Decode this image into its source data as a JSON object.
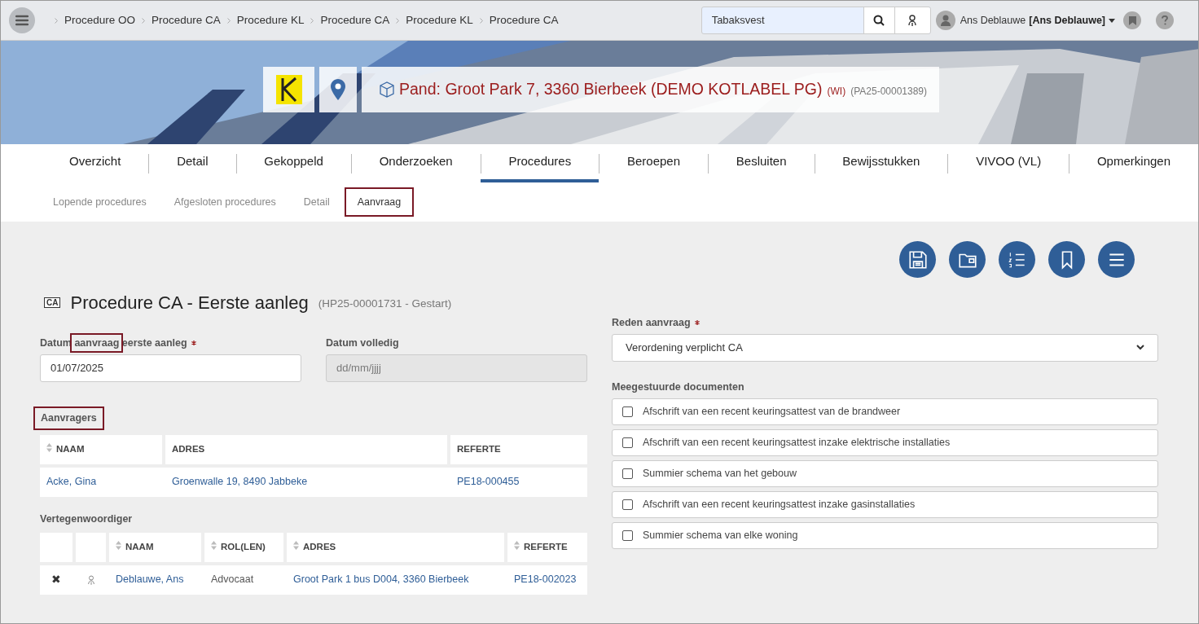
{
  "breadcrumbs": [
    "Procedure OO",
    "Procedure CA",
    "Procedure KL",
    "Procedure CA",
    "Procedure KL",
    "Procedure CA"
  ],
  "search": {
    "value": "Tabaksvest"
  },
  "user": {
    "name": "Ans Deblauwe",
    "role": "[Ans Deblauwe]"
  },
  "header": {
    "title": "Pand: Groot Park 7, 3360 Bierbeek (DEMO KOTLABEL PG)",
    "tag": "(WI)",
    "code": "(PA25-00001389)"
  },
  "tabs": [
    {
      "label": "Overzicht",
      "selected": false
    },
    {
      "label": "Detail",
      "selected": false
    },
    {
      "label": "Gekoppeld",
      "selected": false
    },
    {
      "label": "Onderzoeken",
      "selected": false
    },
    {
      "label": "Procedures",
      "selected": true
    },
    {
      "label": "Beroepen",
      "selected": false
    },
    {
      "label": "Besluiten",
      "selected": false
    },
    {
      "label": "Bewijsstukken",
      "selected": false
    },
    {
      "label": "VIVOO (VL)",
      "selected": false
    },
    {
      "label": "Opmerkingen",
      "selected": false
    }
  ],
  "subtabs": [
    {
      "label": "Lopende procedures",
      "selected": false,
      "highlighted": false
    },
    {
      "label": "Afgesloten procedures",
      "selected": false,
      "highlighted": false
    },
    {
      "label": "Detail",
      "selected": false,
      "highlighted": false
    },
    {
      "label": "Aanvraag",
      "selected": true,
      "highlighted": true
    }
  ],
  "procedure": {
    "badge": "CA",
    "title": "Procedure CA - Eerste aanleg",
    "subtitle": "(HP25-00001731 - Gestart)"
  },
  "fields": [
    {
      "label": [
        {
          "text": "Datum ",
          "highlighted": false
        },
        {
          "text": "aanvraag",
          "highlighted": true
        },
        {
          "text": " eerste aanleg",
          "highlighted": false
        }
      ],
      "required": true,
      "value": "01/07/2025",
      "disabled": false
    },
    {
      "label": [
        {
          "text": "Datum volledig"
        }
      ],
      "required": false,
      "placeholder": "dd/mm/jjjj",
      "disabled": true
    }
  ],
  "reason": {
    "label": "Reden aanvraag",
    "required": true,
    "value": "Verordening verplicht CA"
  },
  "applicants": {
    "title": "Aanvragers",
    "highlighted": true,
    "columns": [
      {
        "label": "NAAM",
        "sortable": true
      },
      {
        "label": "ADRES",
        "sortable": false
      },
      {
        "label": "REFERTE",
        "sortable": false
      }
    ],
    "rows": [
      [
        "Acke, Gina",
        "Groenwalle 19, 8490 Jabbeke",
        "PE18-000455"
      ]
    ]
  },
  "representatives": {
    "title": "Vertegenwoordiger",
    "columns": [
      {
        "label": "NAAM",
        "sortable": true
      },
      {
        "label": "ROL(LEN)",
        "sortable": true
      },
      {
        "label": "ADRES",
        "sortable": true
      },
      {
        "label": "REFERTE",
        "sortable": true
      }
    ],
    "rows": [
      {
        "remove": "✖",
        "cells": [
          "Deblauwe, Ans",
          "Advocaat",
          "Groot Park 1 bus D004, 3360 Bierbeek",
          "PE18-002023"
        ]
      }
    ]
  },
  "documents": {
    "title": "Meegestuurde documenten",
    "items": [
      {
        "label": "Afschrift van een recent keuringsattest van de brandweer",
        "checked": false
      },
      {
        "label": "Afschrift van een recent keuringsattest inzake elektrische installaties",
        "checked": false
      },
      {
        "label": "Summier schema van het gebouw",
        "checked": false
      },
      {
        "label": "Afschrift van een recent keuringsattest inzake gasinstallaties",
        "checked": false
      },
      {
        "label": "Summier schema van elke woning",
        "checked": false
      }
    ]
  }
}
